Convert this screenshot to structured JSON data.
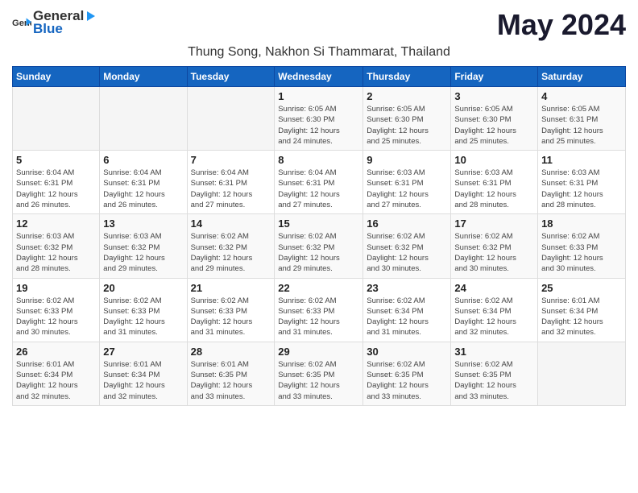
{
  "logo": {
    "text_general": "General",
    "text_blue": "Blue",
    "icon": "▶"
  },
  "title": "May 2024",
  "location": "Thung Song, Nakhon Si Thammarat, Thailand",
  "header_row": [
    "Sunday",
    "Monday",
    "Tuesday",
    "Wednesday",
    "Thursday",
    "Friday",
    "Saturday"
  ],
  "weeks": [
    [
      {
        "day": "",
        "info": ""
      },
      {
        "day": "",
        "info": ""
      },
      {
        "day": "",
        "info": ""
      },
      {
        "day": "1",
        "info": "Sunrise: 6:05 AM\nSunset: 6:30 PM\nDaylight: 12 hours\nand 24 minutes."
      },
      {
        "day": "2",
        "info": "Sunrise: 6:05 AM\nSunset: 6:30 PM\nDaylight: 12 hours\nand 25 minutes."
      },
      {
        "day": "3",
        "info": "Sunrise: 6:05 AM\nSunset: 6:30 PM\nDaylight: 12 hours\nand 25 minutes."
      },
      {
        "day": "4",
        "info": "Sunrise: 6:05 AM\nSunset: 6:31 PM\nDaylight: 12 hours\nand 25 minutes."
      }
    ],
    [
      {
        "day": "5",
        "info": "Sunrise: 6:04 AM\nSunset: 6:31 PM\nDaylight: 12 hours\nand 26 minutes."
      },
      {
        "day": "6",
        "info": "Sunrise: 6:04 AM\nSunset: 6:31 PM\nDaylight: 12 hours\nand 26 minutes."
      },
      {
        "day": "7",
        "info": "Sunrise: 6:04 AM\nSunset: 6:31 PM\nDaylight: 12 hours\nand 27 minutes."
      },
      {
        "day": "8",
        "info": "Sunrise: 6:04 AM\nSunset: 6:31 PM\nDaylight: 12 hours\nand 27 minutes."
      },
      {
        "day": "9",
        "info": "Sunrise: 6:03 AM\nSunset: 6:31 PM\nDaylight: 12 hours\nand 27 minutes."
      },
      {
        "day": "10",
        "info": "Sunrise: 6:03 AM\nSunset: 6:31 PM\nDaylight: 12 hours\nand 28 minutes."
      },
      {
        "day": "11",
        "info": "Sunrise: 6:03 AM\nSunset: 6:31 PM\nDaylight: 12 hours\nand 28 minutes."
      }
    ],
    [
      {
        "day": "12",
        "info": "Sunrise: 6:03 AM\nSunset: 6:32 PM\nDaylight: 12 hours\nand 28 minutes."
      },
      {
        "day": "13",
        "info": "Sunrise: 6:03 AM\nSunset: 6:32 PM\nDaylight: 12 hours\nand 29 minutes."
      },
      {
        "day": "14",
        "info": "Sunrise: 6:02 AM\nSunset: 6:32 PM\nDaylight: 12 hours\nand 29 minutes."
      },
      {
        "day": "15",
        "info": "Sunrise: 6:02 AM\nSunset: 6:32 PM\nDaylight: 12 hours\nand 29 minutes."
      },
      {
        "day": "16",
        "info": "Sunrise: 6:02 AM\nSunset: 6:32 PM\nDaylight: 12 hours\nand 30 minutes."
      },
      {
        "day": "17",
        "info": "Sunrise: 6:02 AM\nSunset: 6:32 PM\nDaylight: 12 hours\nand 30 minutes."
      },
      {
        "day": "18",
        "info": "Sunrise: 6:02 AM\nSunset: 6:33 PM\nDaylight: 12 hours\nand 30 minutes."
      }
    ],
    [
      {
        "day": "19",
        "info": "Sunrise: 6:02 AM\nSunset: 6:33 PM\nDaylight: 12 hours\nand 30 minutes."
      },
      {
        "day": "20",
        "info": "Sunrise: 6:02 AM\nSunset: 6:33 PM\nDaylight: 12 hours\nand 31 minutes."
      },
      {
        "day": "21",
        "info": "Sunrise: 6:02 AM\nSunset: 6:33 PM\nDaylight: 12 hours\nand 31 minutes."
      },
      {
        "day": "22",
        "info": "Sunrise: 6:02 AM\nSunset: 6:33 PM\nDaylight: 12 hours\nand 31 minutes."
      },
      {
        "day": "23",
        "info": "Sunrise: 6:02 AM\nSunset: 6:34 PM\nDaylight: 12 hours\nand 31 minutes."
      },
      {
        "day": "24",
        "info": "Sunrise: 6:02 AM\nSunset: 6:34 PM\nDaylight: 12 hours\nand 32 minutes."
      },
      {
        "day": "25",
        "info": "Sunrise: 6:01 AM\nSunset: 6:34 PM\nDaylight: 12 hours\nand 32 minutes."
      }
    ],
    [
      {
        "day": "26",
        "info": "Sunrise: 6:01 AM\nSunset: 6:34 PM\nDaylight: 12 hours\nand 32 minutes."
      },
      {
        "day": "27",
        "info": "Sunrise: 6:01 AM\nSunset: 6:34 PM\nDaylight: 12 hours\nand 32 minutes."
      },
      {
        "day": "28",
        "info": "Sunrise: 6:01 AM\nSunset: 6:35 PM\nDaylight: 12 hours\nand 33 minutes."
      },
      {
        "day": "29",
        "info": "Sunrise: 6:02 AM\nSunset: 6:35 PM\nDaylight: 12 hours\nand 33 minutes."
      },
      {
        "day": "30",
        "info": "Sunrise: 6:02 AM\nSunset: 6:35 PM\nDaylight: 12 hours\nand 33 minutes."
      },
      {
        "day": "31",
        "info": "Sunrise: 6:02 AM\nSunset: 6:35 PM\nDaylight: 12 hours\nand 33 minutes."
      },
      {
        "day": "",
        "info": ""
      }
    ]
  ]
}
